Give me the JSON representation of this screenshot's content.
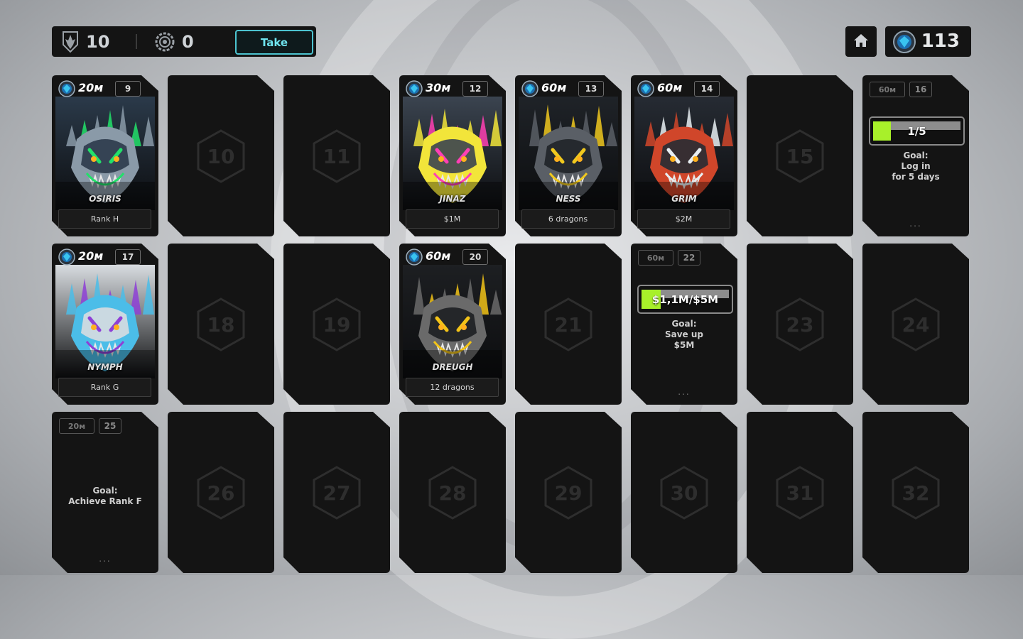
{
  "topbar": {
    "resource_1": {
      "icon": "dragon-emblem-icon",
      "value": "10"
    },
    "resource_2": {
      "icon": "gear-coin-icon",
      "value": "0"
    },
    "take_label": "Take",
    "home_icon": "home-icon",
    "gems": {
      "icon": "blue-gem-icon",
      "value": "113"
    }
  },
  "colors": {
    "background": "#b3b5b8",
    "card": "#141414",
    "accent_cyan": "#4cc3cf",
    "progress_green": "#a8f02a",
    "locked_number": "#2e2e2e"
  },
  "cards": [
    {
      "type": "dragon",
      "cost": "20м",
      "index": "9",
      "name": "OSIRIS",
      "reward": "Rank H",
      "palette": [
        "#2b3a4a",
        "#22e06a",
        "#8a9aa8"
      ]
    },
    {
      "type": "locked",
      "number": "10"
    },
    {
      "type": "locked",
      "number": "11"
    },
    {
      "type": "dragon",
      "cost": "30м",
      "index": "12",
      "name": "JINAZ",
      "reward": "$1M",
      "palette": [
        "#3b4450",
        "#ff3fb4",
        "#f2e53a"
      ]
    },
    {
      "type": "dragon",
      "cost": "60м",
      "index": "13",
      "name": "NESS",
      "reward": "6 dragons",
      "palette": [
        "#1f2328",
        "#f0c81e",
        "#5a5f66"
      ]
    },
    {
      "type": "dragon",
      "cost": "60м",
      "index": "14",
      "name": "GRIM",
      "reward": "$2M",
      "palette": [
        "#262b33",
        "#e8eef2",
        "#d0462a"
      ]
    },
    {
      "type": "locked",
      "number": "15"
    },
    {
      "type": "goal",
      "cost": "60м",
      "index": "16",
      "progress_text": "1/5",
      "progress": 0.2,
      "goal_label": "Goal:",
      "goal_text": [
        "Log in",
        "for 5 days"
      ],
      "dots": "..."
    },
    {
      "type": "dragon",
      "cost": "20м",
      "index": "17",
      "name": "NYMPH",
      "reward": "Rank G",
      "palette": [
        "#d8dce0",
        "#8e3fd6",
        "#4bbde8"
      ]
    },
    {
      "type": "locked",
      "number": "18"
    },
    {
      "type": "locked",
      "number": "19"
    },
    {
      "type": "dragon",
      "cost": "60м",
      "index": "20",
      "name": "DREUGH",
      "reward": "12 dragons",
      "palette": [
        "#1d1f22",
        "#f2c318",
        "#6a6a6a"
      ]
    },
    {
      "type": "locked",
      "number": "21"
    },
    {
      "type": "goal",
      "cost": "60м",
      "index": "22",
      "progress_text": "$1,1M/$5M",
      "progress": 0.22,
      "goal_label": "Goal:",
      "goal_text": [
        "Save up",
        "$5M"
      ],
      "dots": "..."
    },
    {
      "type": "locked",
      "number": "23"
    },
    {
      "type": "locked",
      "number": "24"
    },
    {
      "type": "goal-text",
      "cost": "20м",
      "index": "25",
      "goal_label": "Goal:",
      "goal_text": [
        "Achieve Rank F"
      ],
      "dots": "..."
    },
    {
      "type": "locked",
      "number": "26"
    },
    {
      "type": "locked",
      "number": "27"
    },
    {
      "type": "locked",
      "number": "28"
    },
    {
      "type": "locked",
      "number": "29"
    },
    {
      "type": "locked",
      "number": "30"
    },
    {
      "type": "locked",
      "number": "31"
    },
    {
      "type": "locked",
      "number": "32"
    }
  ]
}
